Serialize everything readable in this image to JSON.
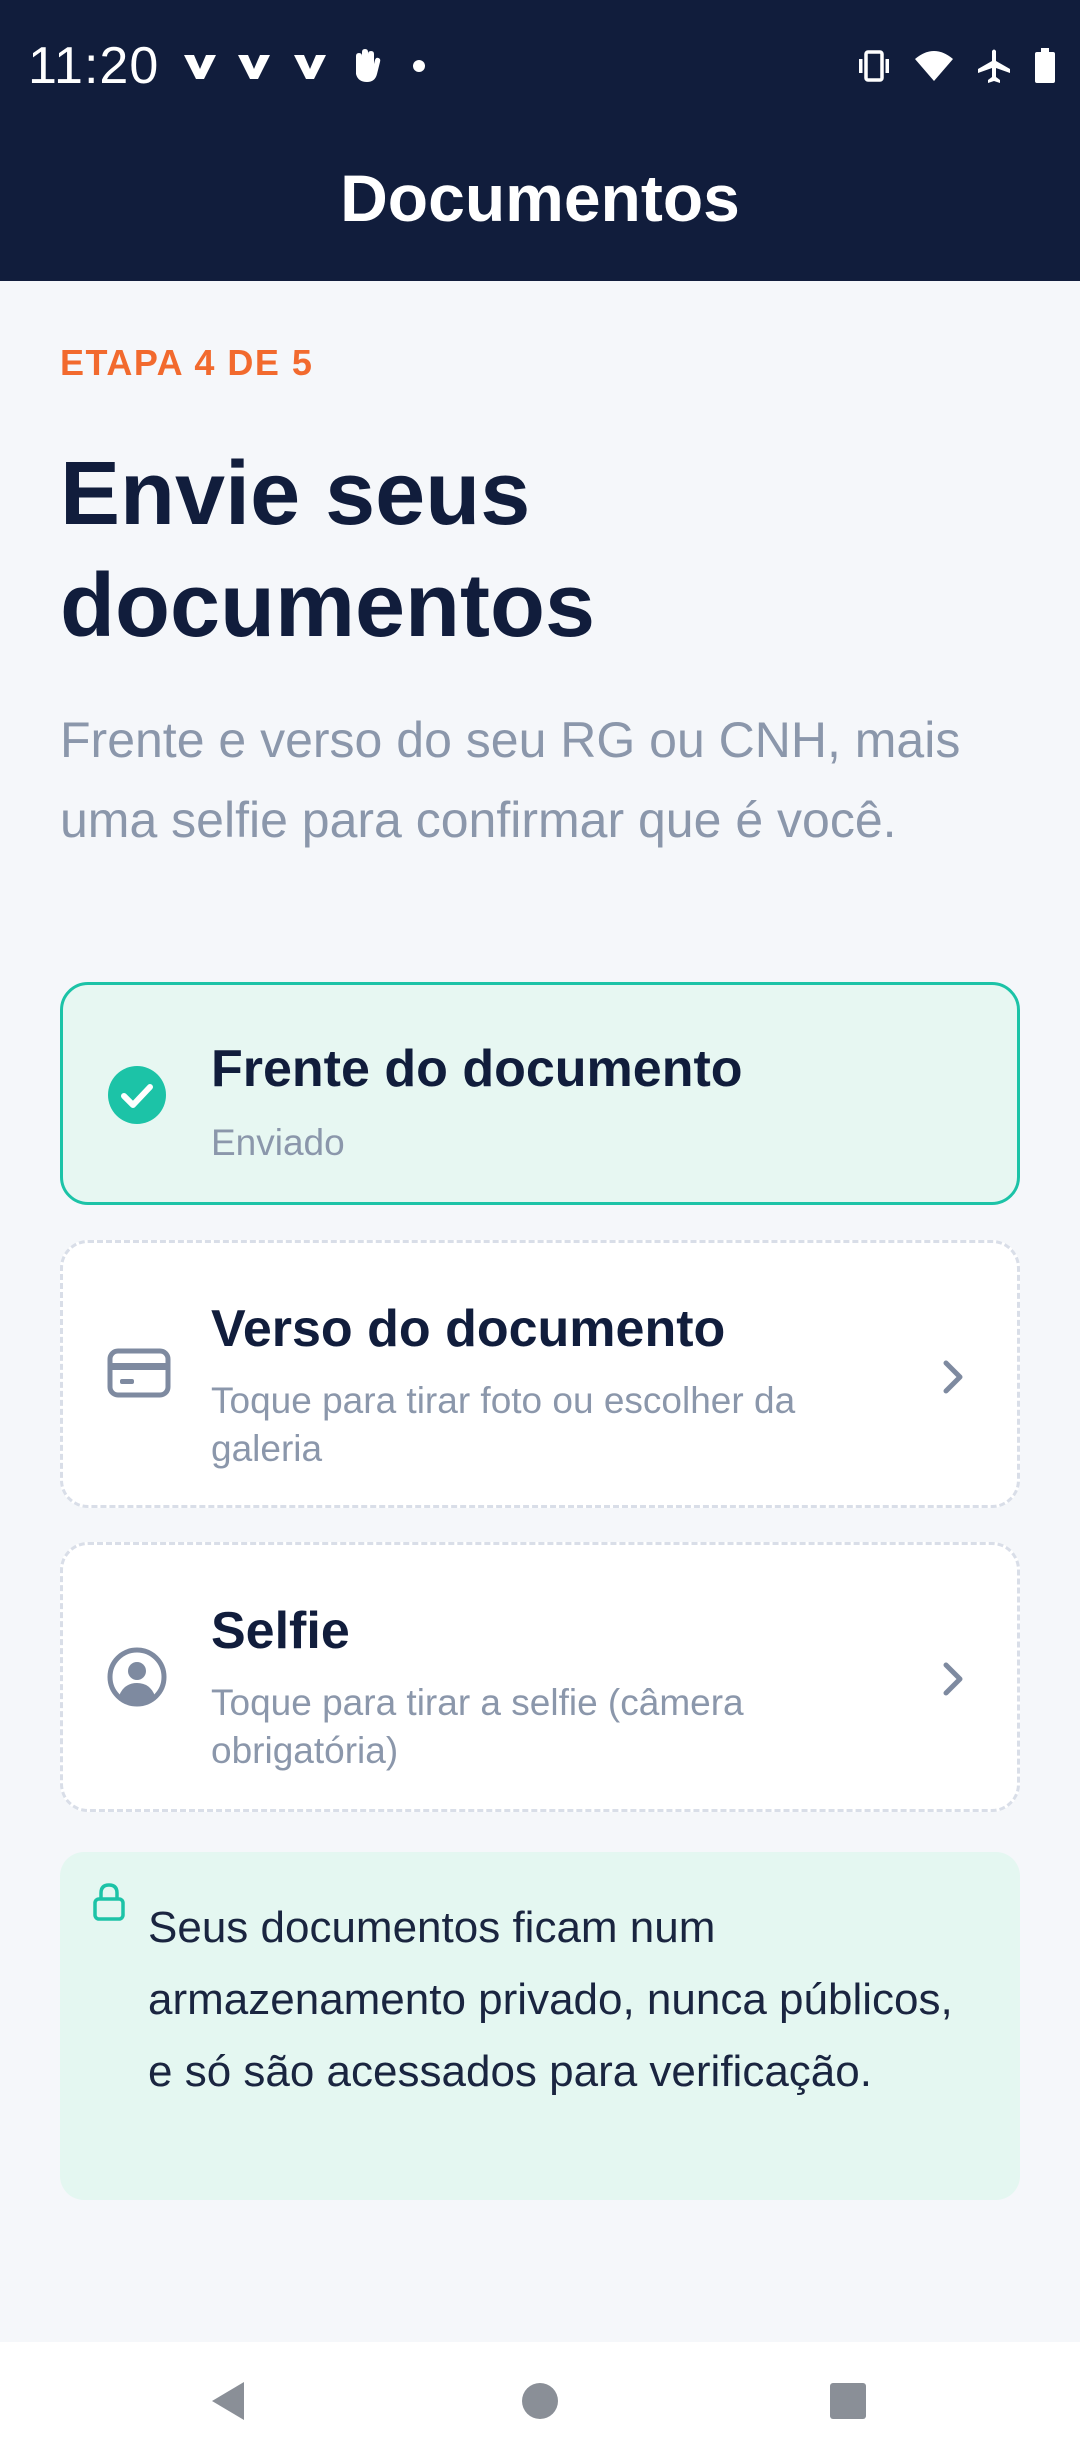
{
  "status_bar": {
    "time": "11:20",
    "notification_icons": [
      "v-notification-icon",
      "v-notification-icon",
      "v-notification-icon",
      "hand-notification-icon",
      "dot-icon"
    ],
    "system_icons": [
      "vibrate-icon",
      "wifi-icon",
      "airplane-icon",
      "battery-icon"
    ]
  },
  "header": {
    "title": "Documentos"
  },
  "step": "ETAPA 4 DE 5",
  "title": "Envie seus documentos",
  "subtitle": "Frente e verso do seu RG ou CNH, mais uma selfie para confirmar que é você.",
  "documents": [
    {
      "title": "Frente do documento",
      "subtitle": "Enviado",
      "status": "done",
      "icon": "check-circle-icon"
    },
    {
      "title": "Verso do documento",
      "subtitle": "Toque para tirar foto ou escolher da galeria",
      "status": "pending",
      "icon": "card-icon"
    },
    {
      "title": "Selfie",
      "subtitle": "Toque para tirar a selfie (câmera obrigatória)",
      "status": "pending",
      "icon": "user-circle-icon"
    }
  ],
  "privacy_note": "Seus documentos ficam num armazenamento privado, nunca públicos, e só são acessados para verificação.",
  "colors": {
    "header_bg": "#111d3c",
    "accent_orange": "#f26a2e",
    "success_teal": "#1cc3a7",
    "muted_text": "#8b97ab"
  },
  "nav_icons": [
    "back-icon",
    "home-icon",
    "recents-icon"
  ]
}
